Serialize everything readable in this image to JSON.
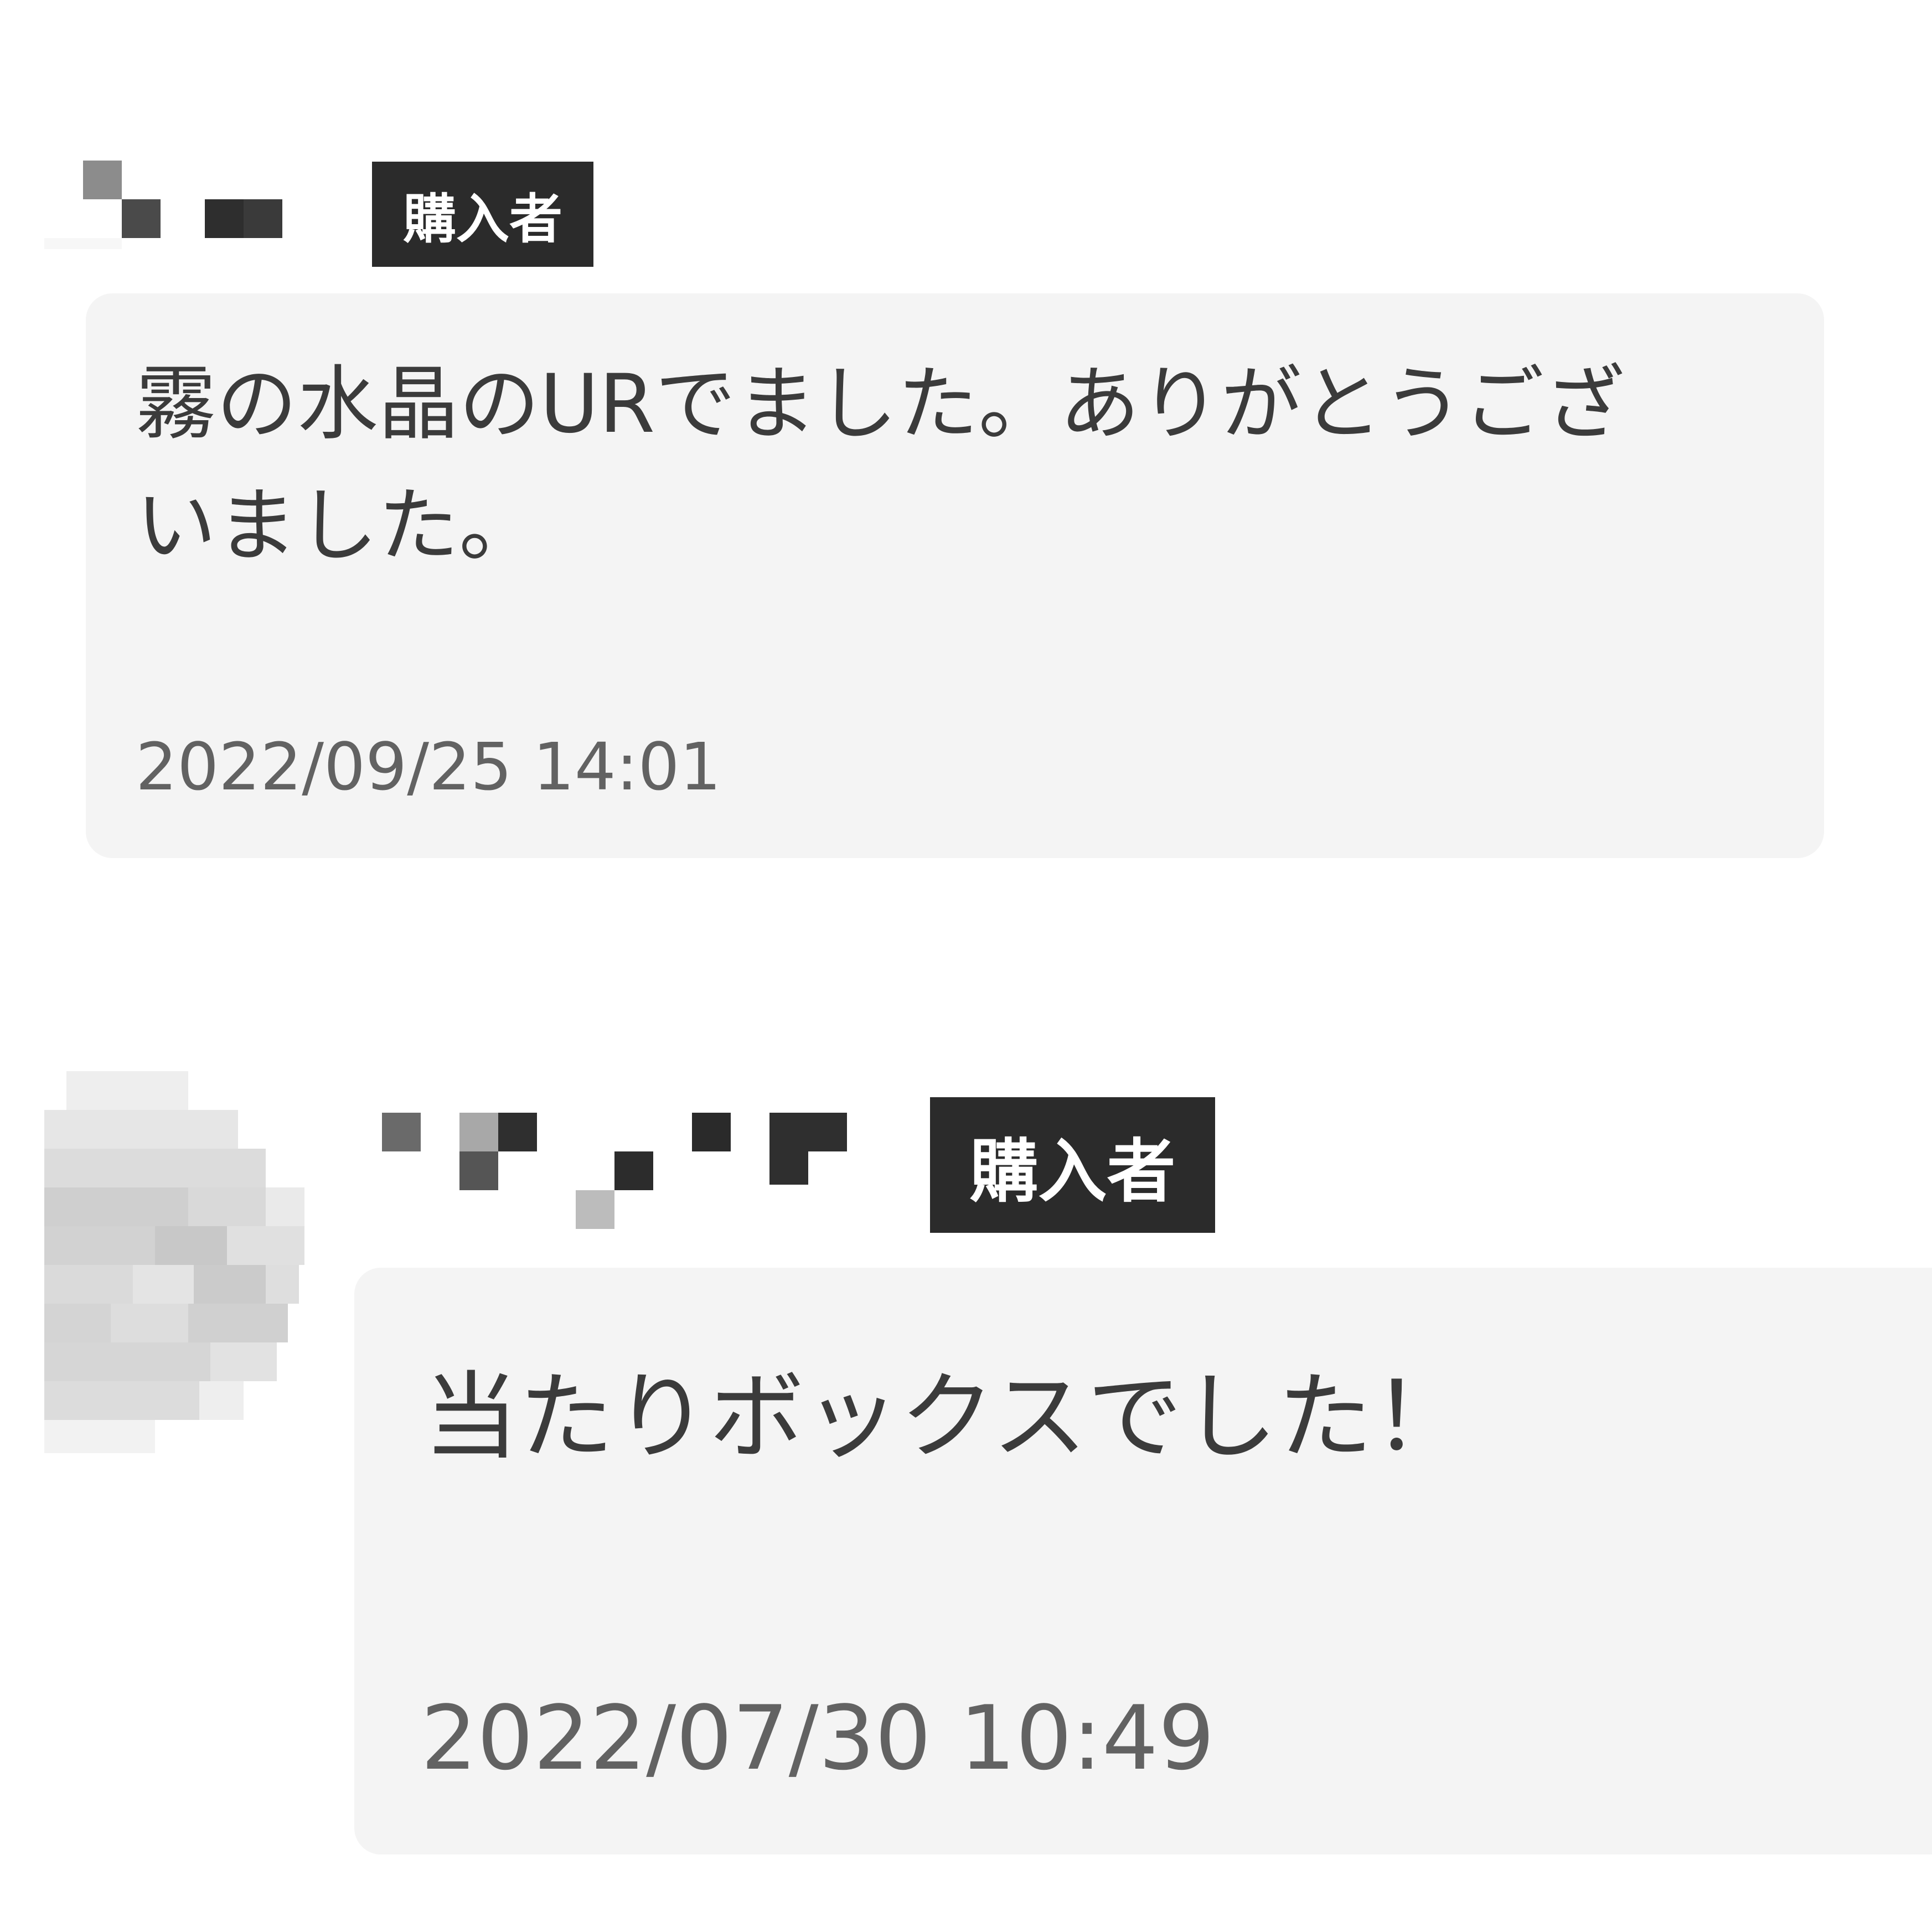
{
  "reviews": [
    {
      "buyer_badge": "購入者",
      "message_lines": [
        "霧の水晶のURでました。ありがとうござ",
        "いました。"
      ],
      "timestamp": "2022/09/25 14:01"
    },
    {
      "buyer_badge": "購入者",
      "message_lines": [
        "当たりボックスでした！"
      ],
      "timestamp": "2022/07/30 10:49"
    }
  ],
  "colors": {
    "bubble_bg": "#f4f4f4",
    "badge_bg": "#2b2b2b",
    "badge_text": "#ffffff",
    "message_text": "#3b3b3b",
    "timestamp_text": "#626262"
  },
  "icons": {
    "username_1": "pixelated-username",
    "username_2": "pixelated-username",
    "avatar_2": "pixelated-avatar"
  }
}
